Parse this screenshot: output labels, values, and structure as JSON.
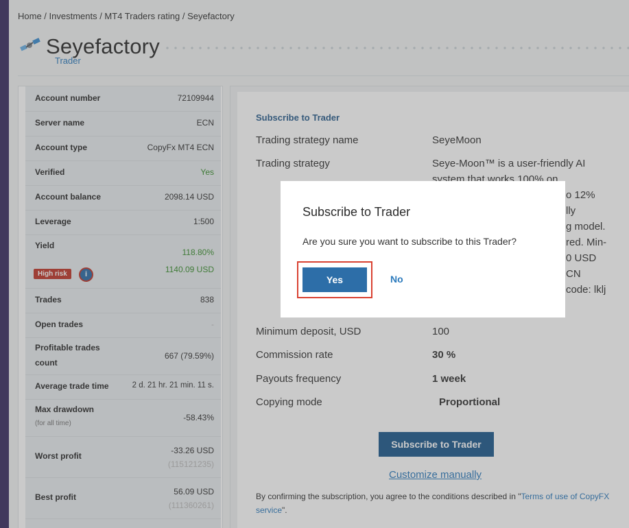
{
  "breadcrumb": "Home / Investments / MT4 Traders rating / Seyefactory",
  "header": {
    "title": "Seyefactory",
    "subtitle": "Trader"
  },
  "account": {
    "account_number_label": "Account number",
    "account_number": "72109944",
    "server_name_label": "Server name",
    "server_name": "ECN",
    "account_type_label": "Account type",
    "account_type": "CopyFx MT4 ECN",
    "verified_label": "Verified",
    "verified": "Yes",
    "balance_label": "Account balance",
    "balance": "2098.14 USD",
    "leverage_label": "Leverage",
    "leverage": "1:500",
    "yield_label": "Yield",
    "yield_pct": "118.80%",
    "yield_usd": "1140.09 USD",
    "risk_badge": "High risk",
    "trades_label": "Trades",
    "trades": "838",
    "open_trades_label": "Open trades",
    "open_trades": "-",
    "profitable_label_1": "Profitable trades",
    "profitable_label_2": "count",
    "profitable": "667 (79.59%)",
    "avg_time_label": "Average trade time",
    "avg_time": "2 d. 21 hr. 21 min. 11 s.",
    "max_dd_label": "Max drawdown",
    "max_dd_sub": "(for all time)",
    "max_dd": "-58.43%",
    "worst_label": "Worst profit",
    "worst": "-33.26 USD",
    "worst_id": "(115121235)",
    "best_label": "Best profit",
    "best": "56.09 USD",
    "best_id": "(111360261)"
  },
  "subscribe": {
    "section_title": "Subscribe to Trader",
    "strategy_name_label": "Trading strategy name",
    "strategy_name": "SeyeMoon",
    "strategy_label": "Trading strategy",
    "strategy_line1": "Seye-Moon™ is a user-friendly AI",
    "strategy_line2": "system that works 100% on",
    "strategy_frag1": "o 12%",
    "strategy_frag2": "lly",
    "strategy_frag3": "g model.",
    "strategy_frag4": "red. Min-",
    "strategy_frag5": "0 USD",
    "strategy_frag6": "CN",
    "strategy_frag7": "code: lklj",
    "min_deposit_label": "Minimum deposit, USD",
    "min_deposit": "100",
    "commission_label": "Commission rate",
    "commission": "30 %",
    "payouts_label": "Payouts frequency",
    "payouts": "1 week",
    "copy_mode_label": "Copying mode",
    "copy_mode": "Proportional",
    "subscribe_button": "Subscribe to Trader",
    "customize_link": "Customize manually",
    "terms_prefix": "By confirming the subscription, you agree to the conditions described in \"",
    "terms_link": "Terms of use of CopyFX service",
    "terms_suffix": "\"."
  },
  "modal": {
    "title": "Subscribe to Trader",
    "text": "Are you sure you want to subscribe to this Trader?",
    "yes": "Yes",
    "no": "No"
  },
  "colors": {
    "accent": "#1f5b8f",
    "link": "#2d7bbd",
    "positive": "#3a8f2f",
    "risk": "#c0392b",
    "background": "#3b2e63"
  }
}
